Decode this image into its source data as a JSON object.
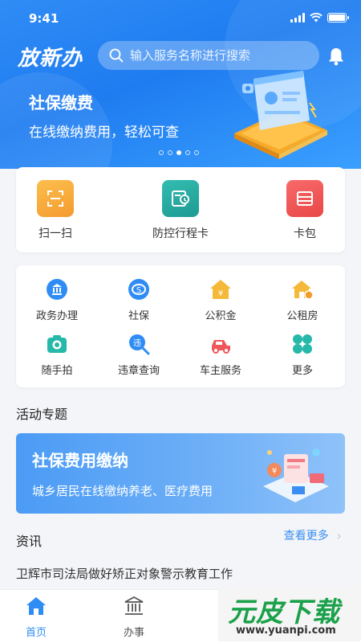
{
  "status_bar": {
    "time": "9:41"
  },
  "header": {
    "logo_text": "放新办",
    "search_placeholder": "输入服务名称进行搜索"
  },
  "banner": {
    "title": "社保缴费",
    "subtitle": "在线缴纳费用，轻松可查",
    "dot_count": 5,
    "active_dot": 2
  },
  "quick_actions": [
    {
      "label": "扫一扫",
      "icon": "scan-icon",
      "color": "#f5a43c"
    },
    {
      "label": "防控行程卡",
      "icon": "travel-card-icon",
      "color": "#26a9a0"
    },
    {
      "label": "卡包",
      "icon": "card-wallet-icon",
      "color": "#f0575a"
    }
  ],
  "services": [
    {
      "label": "政务办理",
      "icon": "government-icon",
      "color": "#2f8cf5"
    },
    {
      "label": "社保",
      "icon": "social-security-icon",
      "color": "#2f8cf5"
    },
    {
      "label": "公积金",
      "icon": "housing-fund-icon",
      "color": "#f5b93a"
    },
    {
      "label": "公租房",
      "icon": "public-housing-icon",
      "color": "#f5b93a"
    },
    {
      "label": "随手拍",
      "icon": "camera-icon",
      "color": "#26b8a8"
    },
    {
      "label": "违章查询",
      "icon": "violation-query-icon",
      "color": "#2f8cf5"
    },
    {
      "label": "车主服务",
      "icon": "car-service-icon",
      "color": "#f0575a"
    },
    {
      "label": "更多",
      "icon": "more-icon",
      "color": "#26b8a8"
    }
  ],
  "activities": {
    "section_title": "活动专题",
    "promo_title": "社保费用缴纳",
    "promo_subtitle": "城乡居民在线缴纳养老、医疗费用"
  },
  "news": {
    "section_title": "资讯",
    "more_label": "查看更多",
    "items": [
      "卫辉市司法局做好矫正对象警示教育工作"
    ]
  },
  "tabbar": {
    "tabs": [
      {
        "label": "首页",
        "icon": "home-icon",
        "active": true
      },
      {
        "label": "办事",
        "icon": "government-building-icon",
        "active": false
      }
    ]
  },
  "watermark": {
    "text": "元皮下载",
    "url": "www.yuanpi.com"
  },
  "colors": {
    "primary": "#2f8cf5",
    "background": "#f3f5f8"
  }
}
